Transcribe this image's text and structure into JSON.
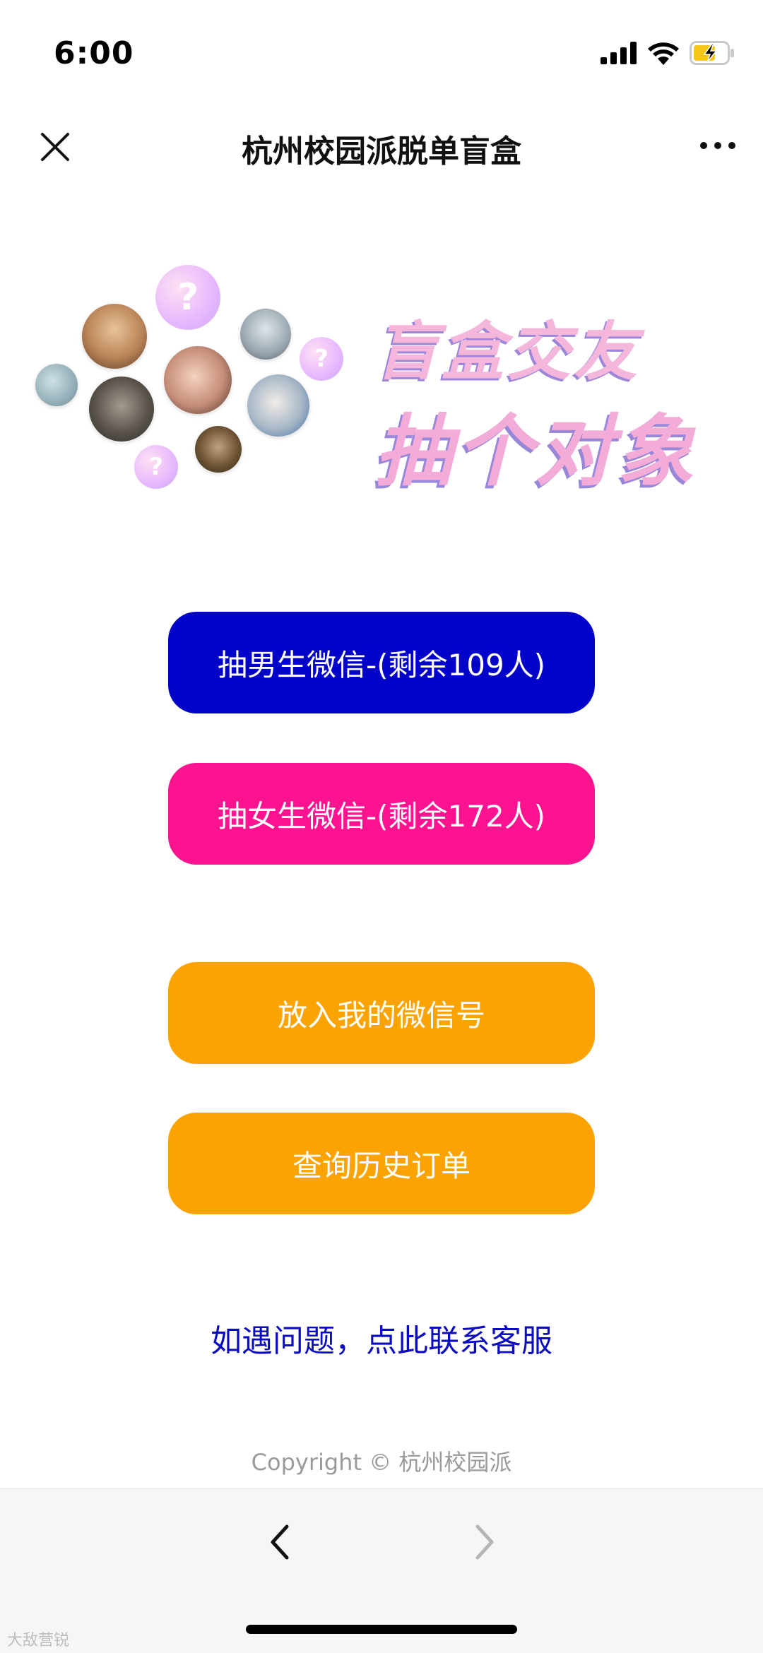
{
  "status_bar": {
    "time": "6:00",
    "icons": [
      "signal-icon",
      "wifi-icon",
      "battery-charging-icon"
    ]
  },
  "nav": {
    "title": "杭州校园派脱单盲盒",
    "close_icon": "close-icon",
    "more_icon": "more-icon"
  },
  "banner": {
    "line1": "盲盒交友",
    "line2": "抽个对象",
    "question_mark": "?"
  },
  "buttons": {
    "male": "抽男生微信-(剩余109人)",
    "female": "抽女生微信-(剩余172人)",
    "put_wechat": "放入我的微信号",
    "query_orders": "查询历史订单"
  },
  "support_link": "如遇问题，点此联系客服",
  "copyright": "Copyright © 杭州校园派",
  "toolbar": {
    "back_icon": "chevron-left-icon",
    "forward_icon": "chevron-right-icon"
  },
  "watermark": "大敌营锐",
  "colors": {
    "male_button": "#0202c9",
    "female_button": "#fd1390",
    "orange_button": "#fca304",
    "link": "#0b0bc0"
  }
}
